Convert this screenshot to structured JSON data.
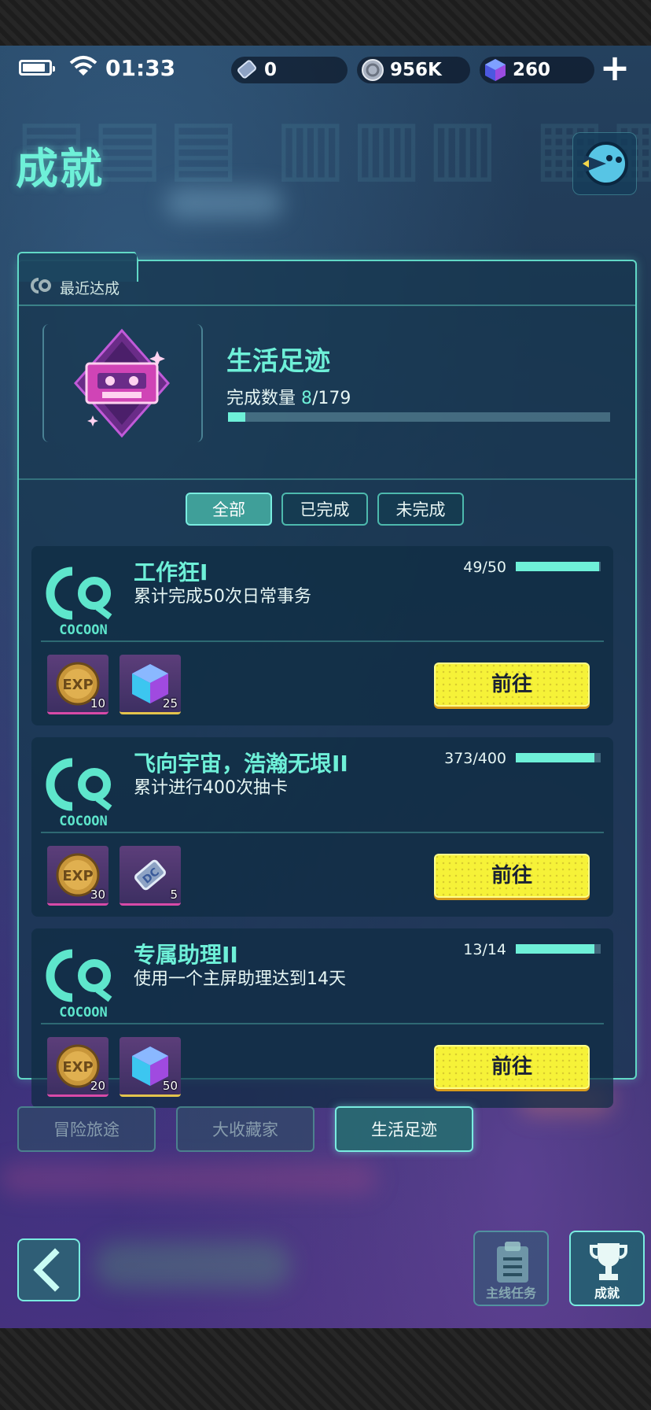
{
  "status": {
    "time": "01:33"
  },
  "resources": [
    {
      "icon": "ticket-icon",
      "value": "0"
    },
    {
      "icon": "coin-icon",
      "value": "956K"
    },
    {
      "icon": "gem-cube-icon",
      "value": "260"
    }
  ],
  "header": {
    "title": "成就"
  },
  "recent": {
    "label": "最近达成",
    "category_title": "生活足迹",
    "progress_label": "完成数量",
    "progress_count": "8",
    "progress_total": "/179",
    "progress_fraction": 0.045
  },
  "filters": [
    "全部",
    "已完成",
    "未完成"
  ],
  "achievements": [
    {
      "title": "工作狂I",
      "desc": "累计完成50次日常事务",
      "count": "49/50",
      "fraction": 0.98,
      "rewards": [
        {
          "type": "exp-coin-icon",
          "qty": "10"
        },
        {
          "type": "gem-cube-icon",
          "qty": "25"
        }
      ],
      "button": "前往"
    },
    {
      "title": "飞向宇宙，浩瀚无垠II",
      "desc": "累计进行400次抽卡",
      "count": "373/400",
      "fraction": 0.93,
      "rewards": [
        {
          "type": "exp-coin-icon",
          "qty": "30"
        },
        {
          "type": "ticket-icon",
          "qty": "5"
        }
      ],
      "button": "前往"
    },
    {
      "title": "专属助理II",
      "desc": "使用一个主屏助理达到14天",
      "count": "13/14",
      "fraction": 0.93,
      "rewards": [
        {
          "type": "exp-coin-icon",
          "qty": "20"
        },
        {
          "type": "gem-cube-icon",
          "qty": "50"
        }
      ],
      "button": "前往"
    }
  ],
  "category_tabs": [
    "冒险旅途",
    "大收藏家",
    "生活足迹"
  ],
  "nav": {
    "main_quest": "主线任务",
    "achievement": "成就"
  },
  "colors": {
    "accent": "#6ef0d8",
    "button_yellow": "#f6f238",
    "panel_border": "#61d8c6"
  }
}
